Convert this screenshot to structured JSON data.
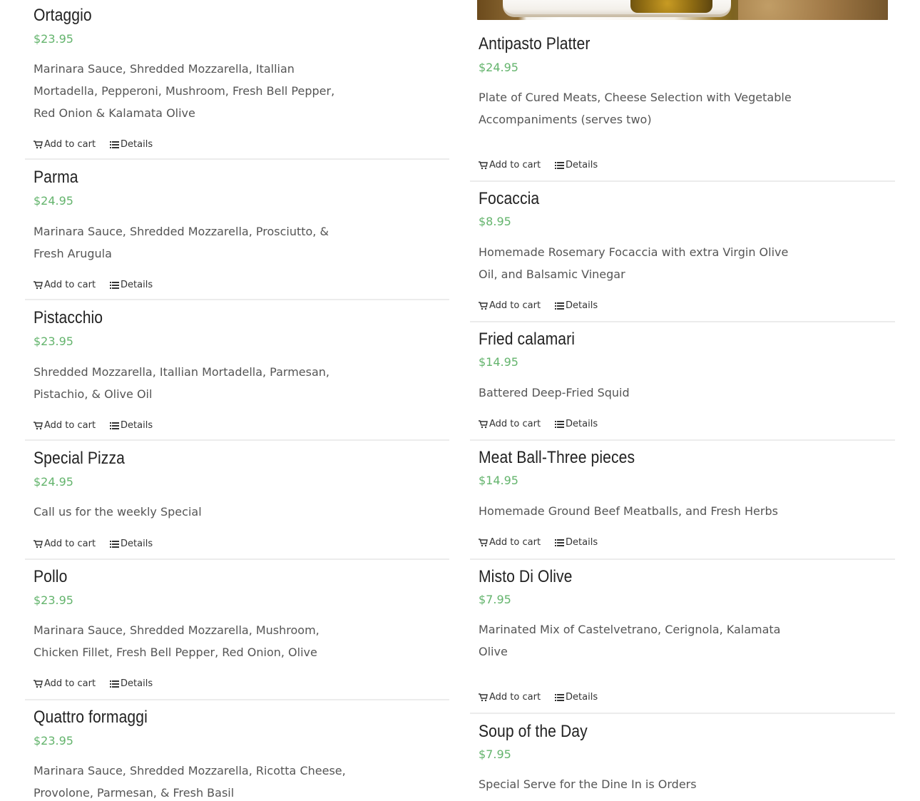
{
  "menu": {
    "left": [
      {
        "title": "Ortaggio",
        "price": "$23.95",
        "description": "Marinara Sauce, Shredded Mozzarella, Itallian Mortadella, Pepperoni, Mushroom, Fresh Bell Pepper, Red Onion & Kalamata Olive",
        "add_to_cart": "Add to cart",
        "details": "Details"
      },
      {
        "title": "Parma",
        "price": "$24.95",
        "description": "Marinara Sauce, Shredded Mozzarella, Prosciutto, & Fresh Arugula",
        "add_to_cart": "Add to cart",
        "details": "Details"
      },
      {
        "title": "Pistacchio",
        "price": "$23.95",
        "description": "Shredded Mozzarella, Itallian Mortadella, Parmesan, Pistachio, & Olive Oil",
        "add_to_cart": "Add to cart",
        "details": "Details"
      },
      {
        "title": "Special Pizza",
        "price": "$24.95",
        "description": "Call us for the weekly Special",
        "add_to_cart": "Add to cart",
        "details": "Details"
      },
      {
        "title": "Pollo",
        "price": "$23.95",
        "description": "Marinara Sauce, Shredded Mozzarella, Mushroom, Chicken Fillet, Fresh Bell Pepper, Red Onion, Olive",
        "add_to_cart": "Add to cart",
        "details": "Details"
      },
      {
        "title": "Quattro formaggi",
        "price": "$23.95",
        "description": "Marinara Sauce, Shredded Mozzarella, Ricotta Cheese, Provolone, Parmesan, & Fresh Basil"
      }
    ],
    "right": [
      {
        "title": "Antipasto Platter",
        "price": "$24.95",
        "description": "Plate of Cured Meats, Cheese Selection with Vegetable Accompaniments (serves two)",
        "add_to_cart": "Add to cart",
        "details": "Details"
      },
      {
        "title": "Focaccia",
        "price": "$8.95",
        "description": "Homemade Rosemary Focaccia with extra Virgin Olive Oil, and Balsamic Vinegar",
        "add_to_cart": "Add to cart",
        "details": "Details"
      },
      {
        "title": "Fried calamari",
        "price": "$14.95",
        "description": "Battered Deep-Fried Squid",
        "add_to_cart": "Add to cart",
        "details": "Details"
      },
      {
        "title": "Meat Ball-Three pieces",
        "price": "$14.95",
        "description": "Homemade Ground Beef Meatballs, and Fresh Herbs",
        "add_to_cart": "Add to cart",
        "details": "Details"
      },
      {
        "title": "Misto Di Olive",
        "price": "$7.95",
        "description": "Marinated Mix of Castelvetrano, Cerignola, Kalamata Olive",
        "add_to_cart": "Add to cart",
        "details": "Details"
      },
      {
        "title": "Soup of the Day",
        "price": "$7.95",
        "description": "Special Serve for the Dine In is Orders"
      }
    ]
  },
  "theme": {
    "price_color": "#64b46d",
    "title_color": "#222222",
    "text_color": "#555555",
    "divider_color": "#ececec"
  },
  "icons": {
    "cart": "shopping-cart-icon",
    "details": "list-icon"
  }
}
